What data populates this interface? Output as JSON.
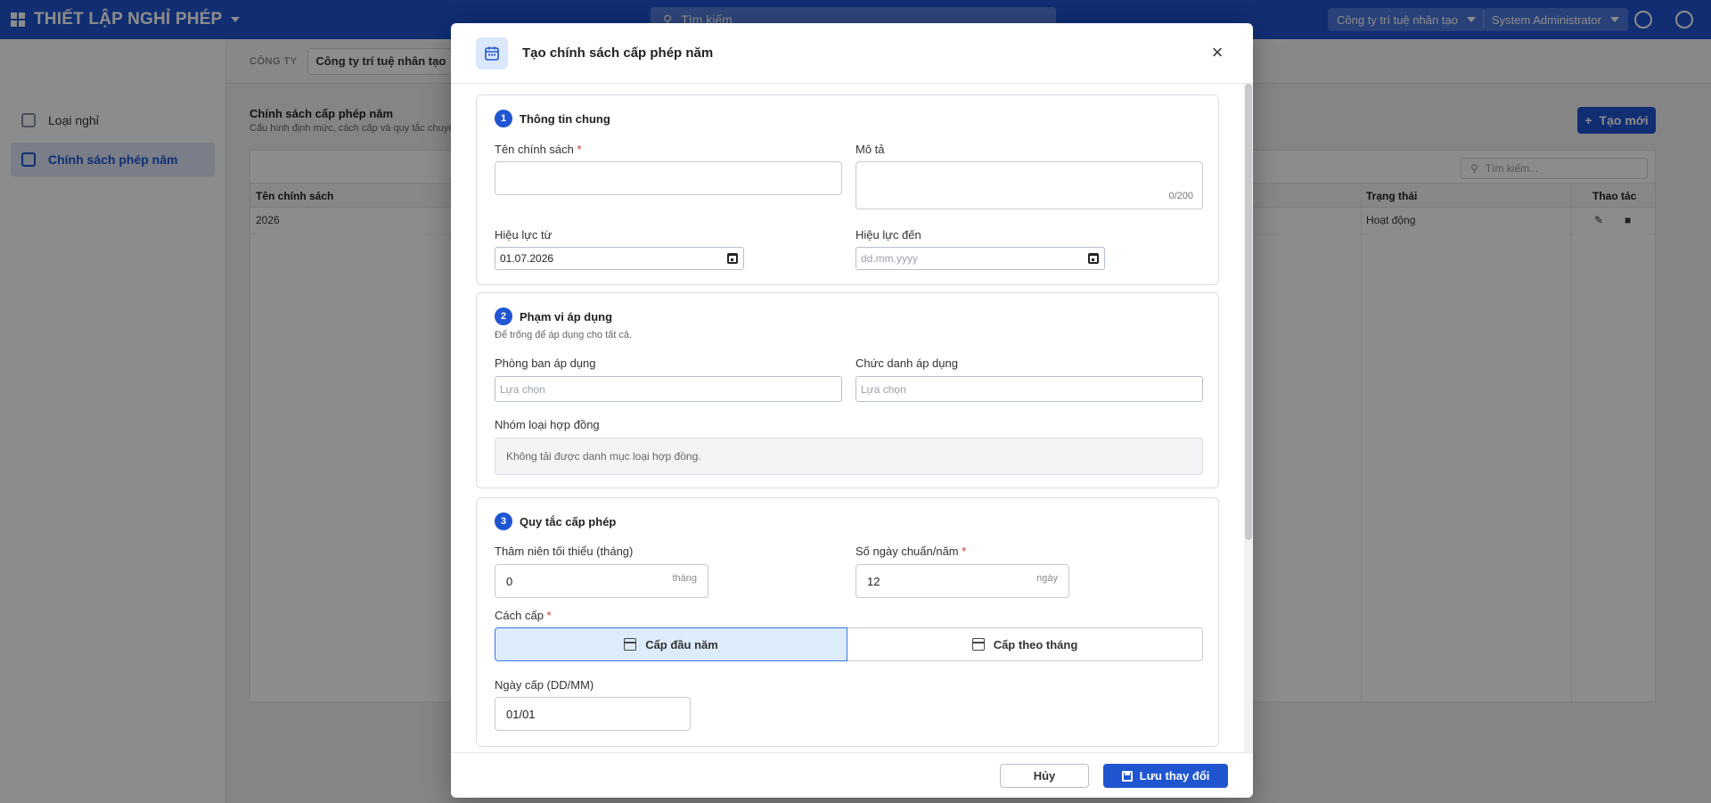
{
  "app": {
    "title": "THIẾT LẬP NGHỈ PHÉP",
    "search_placeholder": "Tìm kiếm",
    "company_selector": "Công ty trí tuệ nhân tạo",
    "user": "System Administrator"
  },
  "company_bar": {
    "label": "CÔNG TY",
    "value": "Công ty trí tuệ nhân tạo"
  },
  "sidebar": {
    "items": [
      {
        "label": "Loại nghỉ",
        "icon": "layers-icon"
      },
      {
        "label": "Chính sách phép năm",
        "icon": "calendar-icon",
        "active": true
      }
    ]
  },
  "content": {
    "title": "Chính sách cấp phép năm",
    "subtitle": "Cấu hình định mức, cách cấp và quy tắc chuyển",
    "new_button": "Tạo mới",
    "table_search_placeholder": "Tìm kiếm...",
    "columns": [
      "Tên chính sách",
      "Trạng thái",
      "Thao tác"
    ],
    "rows": [
      {
        "name": "2026",
        "status": "Hoạt động"
      }
    ]
  },
  "modal": {
    "title": "Tạo chính sách cấp phép năm",
    "section1": {
      "number": "1",
      "title": "Thông tin chung",
      "name_label": "Tên chính sách",
      "name_value": "",
      "desc_label": "Mô tả",
      "desc_counter": "0/200",
      "from_label": "Hiệu lực từ",
      "from_value": "01.07.2026",
      "to_label": "Hiệu lực đến",
      "to_placeholder": "dd.mm.yyyy"
    },
    "section2": {
      "number": "2",
      "title": "Phạm vi áp dụng",
      "hint": "Để trống để áp dụng cho tất cả.",
      "dept_label": "Phòng ban áp dụng",
      "dept_placeholder": "Lựa chọn",
      "title_label": "Chức danh áp dụng",
      "title_placeholder": "Lựa chọn",
      "contract_label": "Nhóm loại hợp đồng",
      "contract_message": "Không tải được danh mục loại hợp đồng."
    },
    "section3": {
      "number": "3",
      "title": "Quy tắc cấp phép",
      "seniority_label": "Thâm niên tối thiểu (tháng)",
      "seniority_value": "0",
      "seniority_suffix": "tháng",
      "days_label": "Số ngày chuẩn/năm",
      "days_value": "12",
      "days_suffix": "ngày",
      "method_label": "Cách cấp",
      "method_options": [
        "Cấp đầu năm",
        "Cấp theo tháng"
      ],
      "method_selected": "Cấp đầu năm",
      "grant_date_label": "Ngày cấp (DD/MM)",
      "grant_date_value": "01/01"
    },
    "footer": {
      "cancel": "Hủy",
      "save": "Lưu thay đổi"
    }
  },
  "colors": {
    "primary": "#1f55d1",
    "required": "#d03030",
    "selected_bg": "#dcecfb"
  }
}
